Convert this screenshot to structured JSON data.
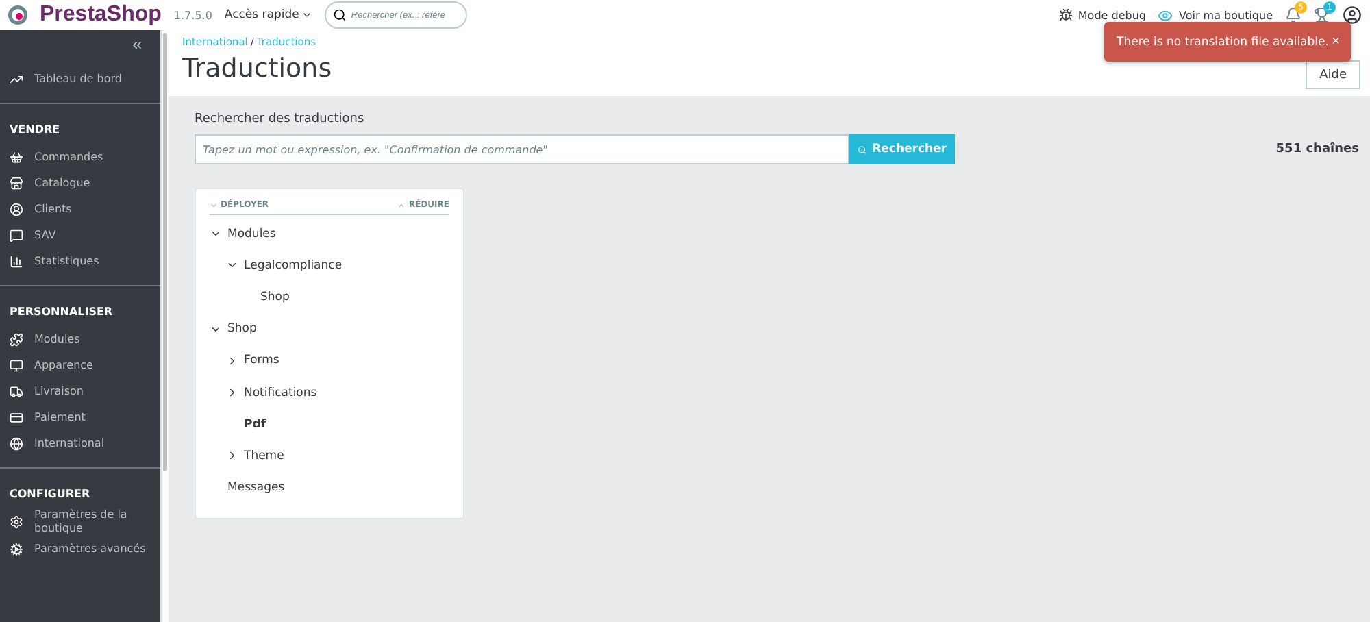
{
  "header": {
    "brand": "PrestaShop",
    "version": "1.7.5.0",
    "quick_access": "Accès rapide",
    "search": {
      "placeholder": "Rechercher (ex. : référe"
    },
    "debug": "Mode debug",
    "view_shop": "Voir ma boutique",
    "notifications": "5",
    "achievements": "1"
  },
  "sidebar": {
    "top": {
      "label": "Tableau de bord"
    },
    "sections": [
      {
        "title": "VENDRE",
        "items": [
          {
            "label": "Commandes"
          },
          {
            "label": "Catalogue"
          },
          {
            "label": "Clients"
          },
          {
            "label": "SAV"
          },
          {
            "label": "Statistiques"
          }
        ]
      },
      {
        "title": "PERSONNALISER",
        "items": [
          {
            "label": "Modules"
          },
          {
            "label": "Apparence"
          },
          {
            "label": "Livraison"
          },
          {
            "label": "Paiement"
          },
          {
            "label": "International"
          }
        ]
      },
      {
        "title": "CONFIGURER",
        "items": [
          {
            "label": "Paramètres de la boutique"
          },
          {
            "label": "Paramètres avancés"
          }
        ]
      }
    ]
  },
  "breadcrumb": {
    "items": [
      "International",
      "Traductions"
    ],
    "separator": "/"
  },
  "page_title": "Traductions",
  "help_button": "Aide",
  "toast": {
    "message": "There is no translation file available.",
    "close": "×"
  },
  "search": {
    "label": "Rechercher des traductions",
    "placeholder": "Tapez un mot ou expression, ex. \"Confirmation de commande\"",
    "button": "Rechercher",
    "count": "551 chaînes"
  },
  "tree": {
    "expand_all": "DÉPLOYER",
    "collapse_all": "RÉDUIRE",
    "nodes": [
      {
        "label": "Modules",
        "kind": "folder",
        "expanded": true,
        "selected": false,
        "children": [
          {
            "label": "Legalcompliance",
            "kind": "folder",
            "expanded": true,
            "selected": false,
            "children": [
              {
                "label": "Shop",
                "kind": "leaf",
                "selected": false
              }
            ]
          }
        ]
      },
      {
        "label": "Shop",
        "kind": "folder",
        "expanded": true,
        "selected": false,
        "children": [
          {
            "label": "Forms",
            "kind": "folder",
            "expanded": false,
            "selected": false
          },
          {
            "label": "Notifications",
            "kind": "folder",
            "expanded": false,
            "selected": false
          },
          {
            "label": "Pdf",
            "kind": "leaf",
            "selected": true
          },
          {
            "label": "Theme",
            "kind": "folder",
            "expanded": false,
            "selected": false
          }
        ]
      },
      {
        "label": "Messages",
        "kind": "leaf",
        "selected": false
      }
    ]
  }
}
